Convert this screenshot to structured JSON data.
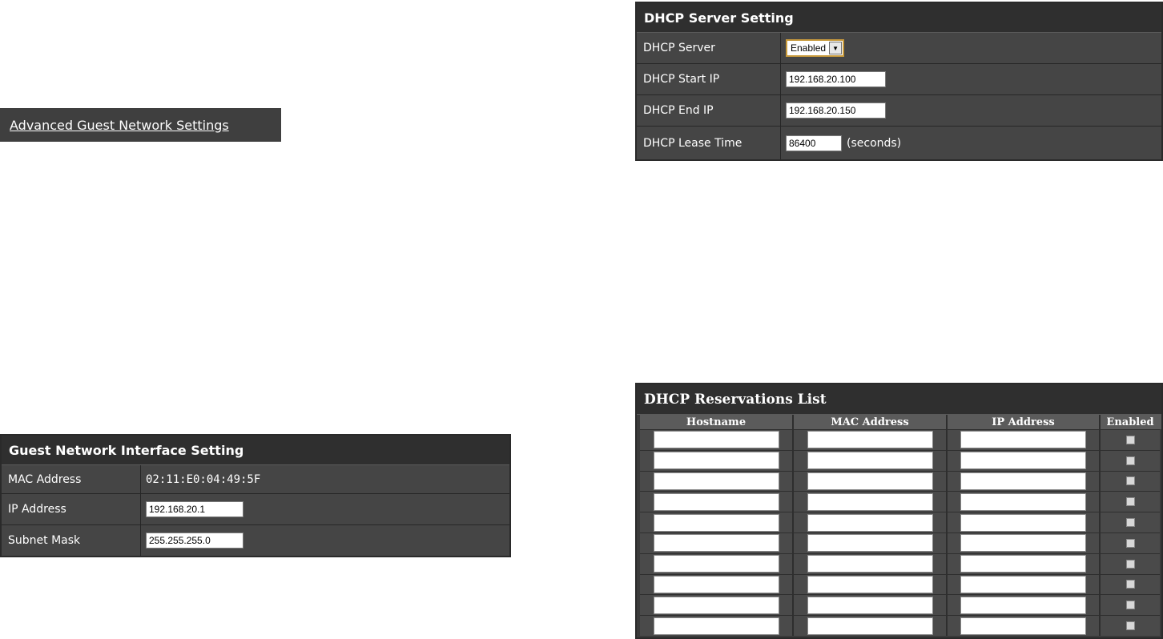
{
  "advanced_link": {
    "label": "Advanced Guest Network Settings"
  },
  "dhcp_server": {
    "title": "DHCP Server Setting",
    "rows": {
      "server": {
        "label": "DHCP Server",
        "value": "Enabled"
      },
      "start_ip": {
        "label": "DHCP Start IP",
        "value": "192.168.20.100"
      },
      "end_ip": {
        "label": "DHCP End IP",
        "value": "192.168.20.150"
      },
      "lease": {
        "label": "DHCP Lease Time",
        "value": "86400",
        "unit": "(seconds)"
      }
    }
  },
  "guest_interface": {
    "title": "Guest Network Interface Setting",
    "rows": {
      "mac": {
        "label": "MAC Address",
        "value": "02:11:E0:04:49:5F"
      },
      "ip": {
        "label": "IP Address",
        "value": "192.168.20.1"
      },
      "mask": {
        "label": "Subnet Mask",
        "value": "255.255.255.0"
      }
    }
  },
  "reservations": {
    "title": "DHCP Reservations List",
    "columns": [
      "Hostname",
      "MAC Address",
      "IP Address",
      "Enabled"
    ],
    "row_count": 10
  },
  "colors": {
    "panel_bg": "#3a3a3a",
    "header_bg": "#2f2f2f",
    "select_border": "#c89a3c"
  }
}
